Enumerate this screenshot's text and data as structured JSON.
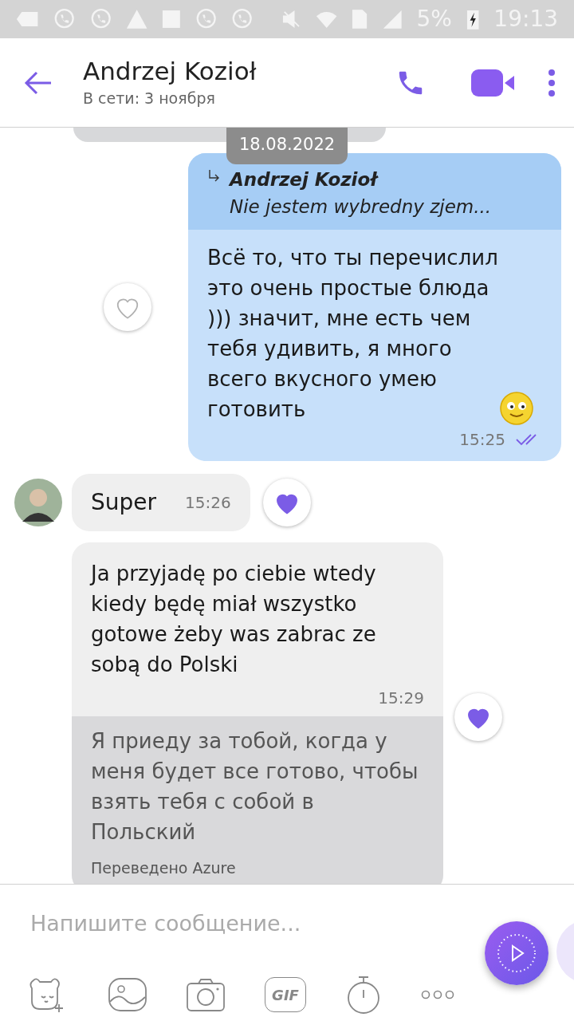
{
  "status_bar": {
    "battery": "5%",
    "time": "19:13"
  },
  "header": {
    "name": "Andrzej Kozioł",
    "status": "В сети: 3 ноября"
  },
  "date_label": "18.08.2022",
  "messages": [
    {
      "kind": "outgoing",
      "quote_author": "Andrzej Kozioł",
      "quote_text": "Nie jestem wybredny zjem...",
      "text": "Всё то, что ты перечислил это очень простые блюда ))) значит, мне есть чем тебя удивить, я много всего вкусного умею готовить",
      "time": "15:25",
      "read": true,
      "liked": false
    },
    {
      "kind": "incoming",
      "text": "Super",
      "time": "15:26",
      "liked": true
    },
    {
      "kind": "translated",
      "text": "Ja przyjadę po ciebie wtedy kiedy będę miał wszystko gotowe żeby was zabrac ze sobą do Polski",
      "time": "15:29",
      "translation": "Я приеду за тобой, когда у меня будет все готово, чтобы взять тебя с собой в Польский",
      "translation_note": "Переведено Azure",
      "liked": true
    }
  ],
  "composer": {
    "placeholder": "Напишите сообщение...",
    "gif_label": "GIF"
  }
}
